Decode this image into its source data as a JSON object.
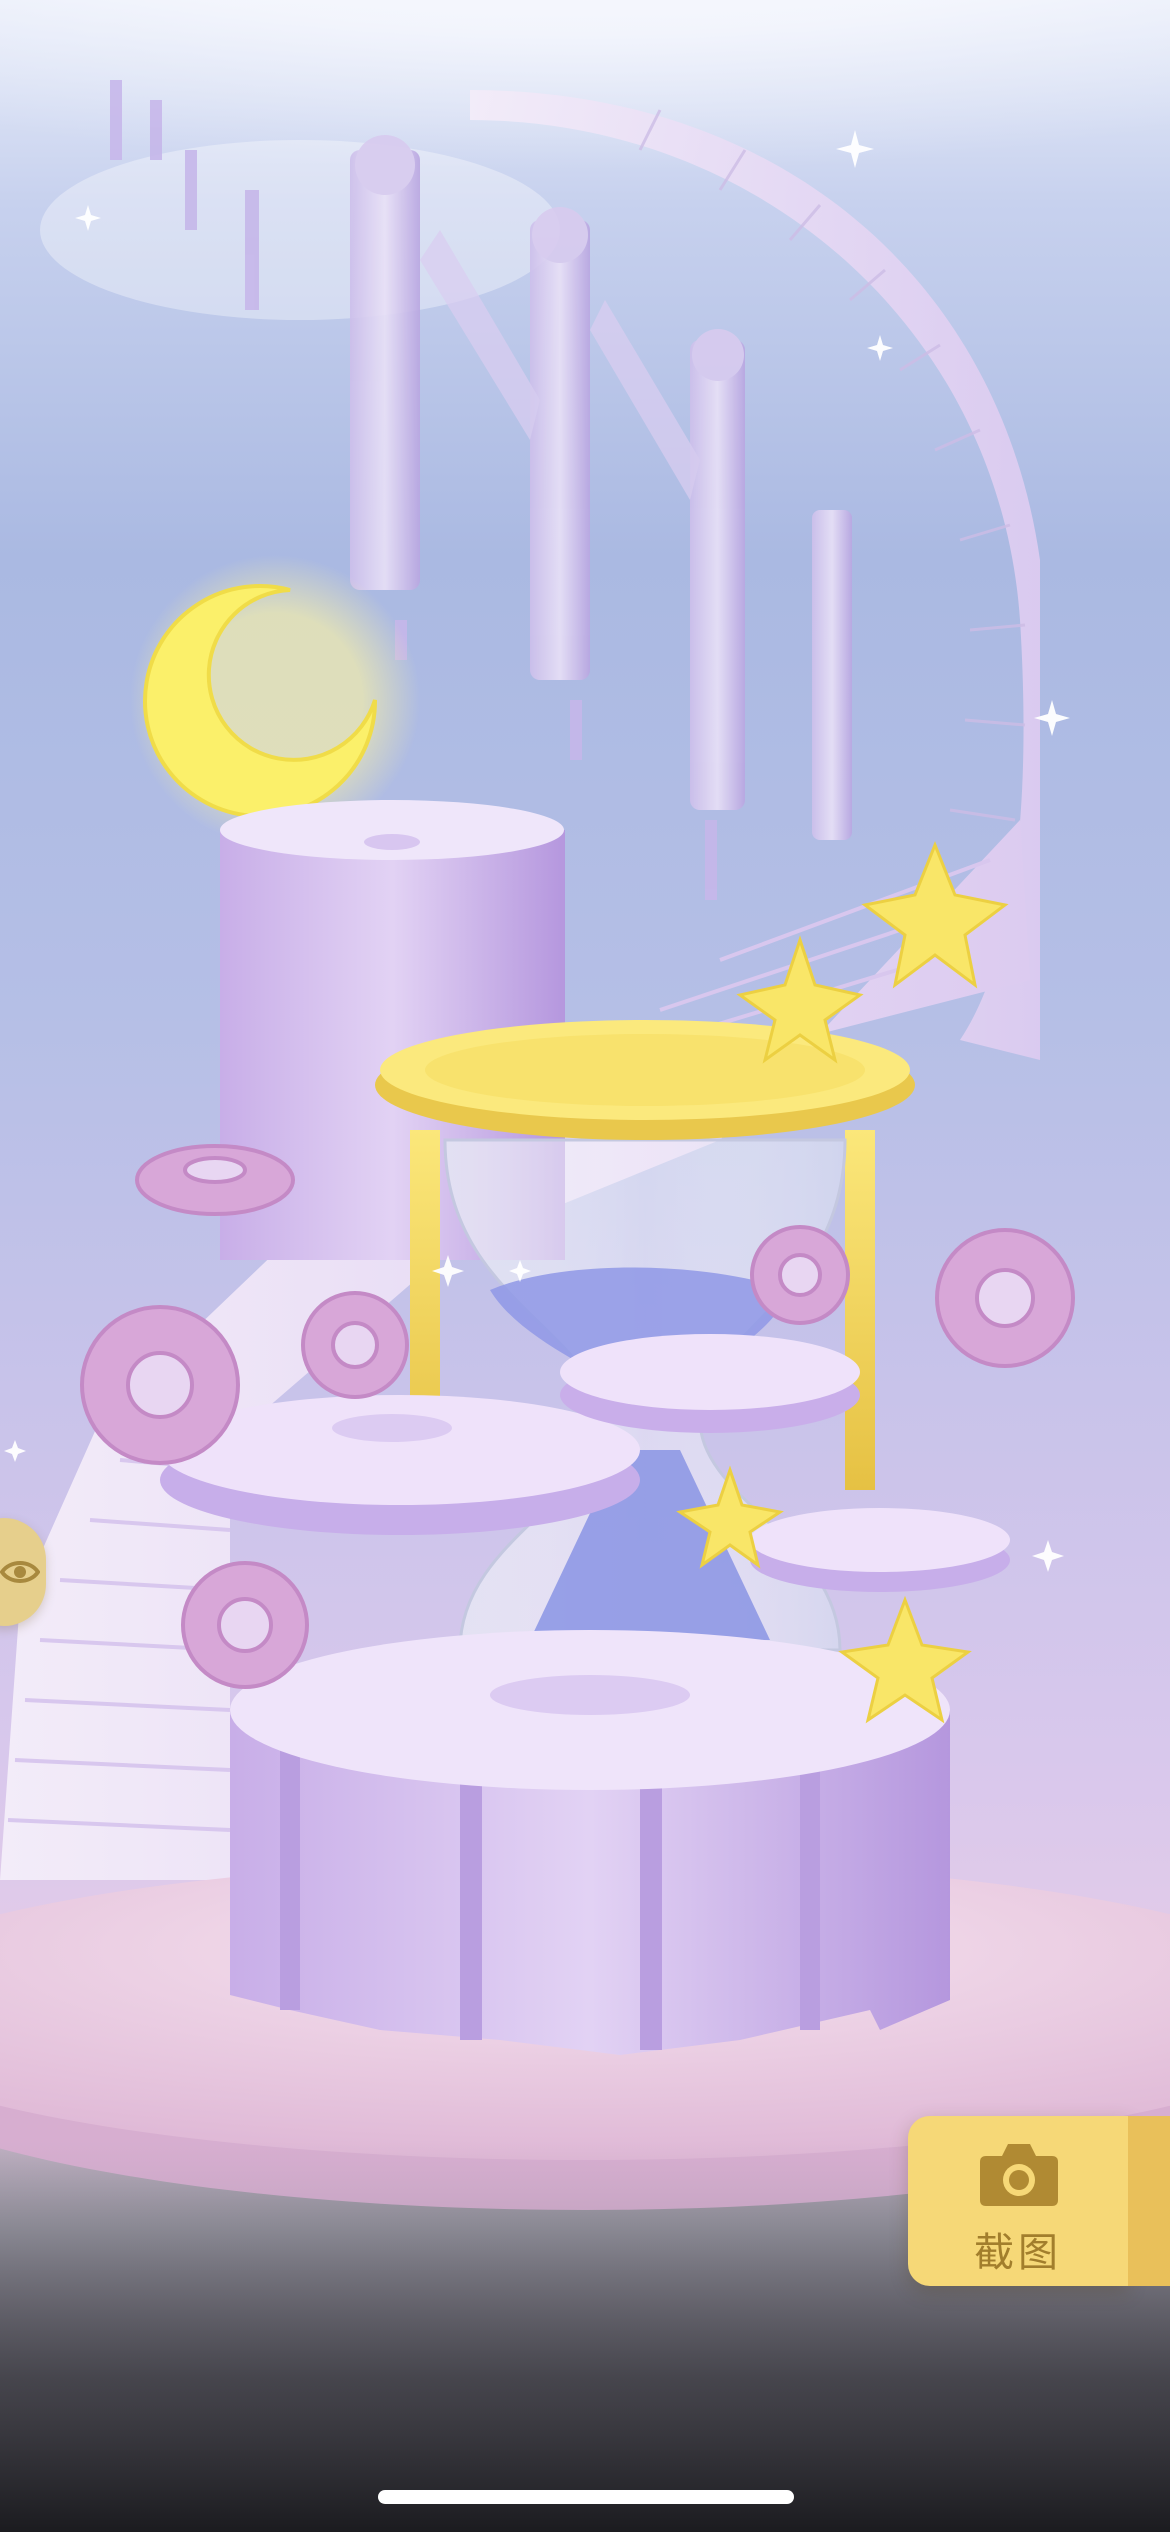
{
  "screen": {
    "type": "game-scene",
    "scene_description_icons": [
      "crescent-moon",
      "yellow-star",
      "hourglass",
      "gear-platform",
      "spiral-staircase",
      "clock-tower-pillars"
    ]
  },
  "side_tab": {
    "icon": "eye-icon"
  },
  "screenshot_button": {
    "icon": "camera-icon",
    "label": "截图"
  },
  "colors": {
    "accent_yellow": "#f6d877",
    "accent_yellow_dark": "#e9c05a",
    "label_brown": "#a27e2c",
    "lavender": "#c9b4e6",
    "pink_platform": "#f0d3e8"
  }
}
